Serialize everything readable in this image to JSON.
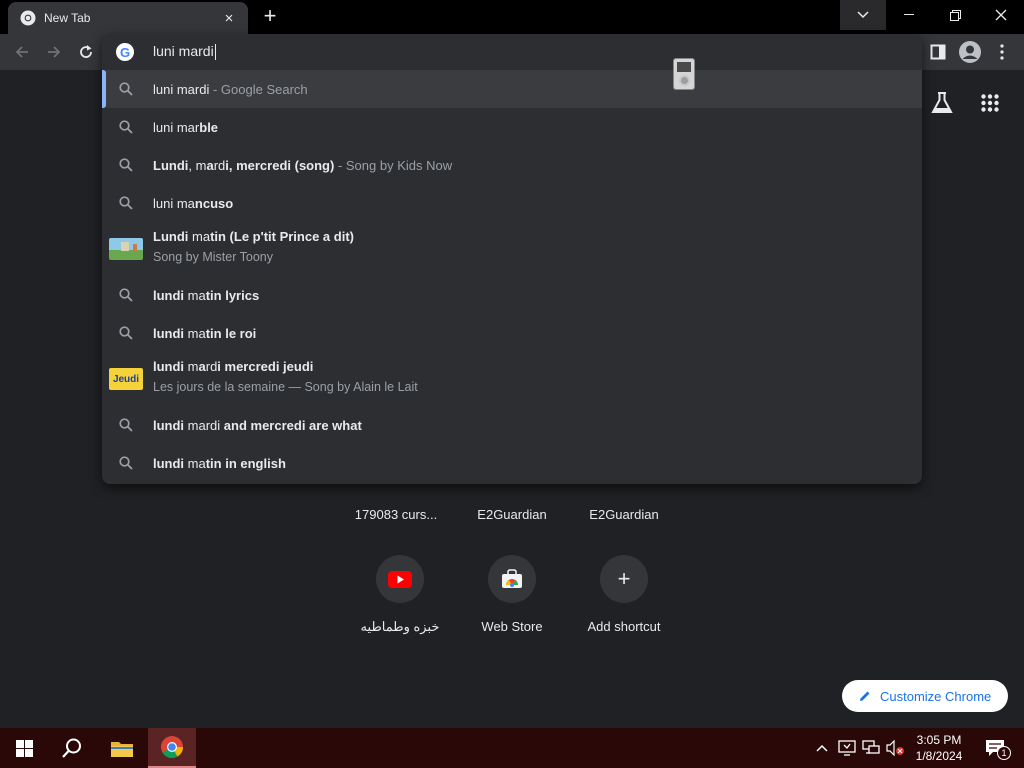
{
  "tab": {
    "title": "New Tab",
    "close_glyph": "×"
  },
  "newtab": {
    "glyph": "+"
  },
  "omnibox": {
    "typed": "luni mardi",
    "suggestions": [
      {
        "parts": [
          {
            "t": "luni mardi",
            "b": false
          }
        ],
        "suffix": " - Google Search",
        "icon": "search-icon",
        "selected": true
      },
      {
        "parts": [
          {
            "t": "luni mar",
            "b": false
          },
          {
            "t": "ble",
            "b": true
          }
        ],
        "icon": "search-icon"
      },
      {
        "parts": [
          {
            "t": "Lundi",
            "b": true
          },
          {
            "t": ", m",
            "b": false
          },
          {
            "t": "a",
            "b": true
          },
          {
            "t": "rd",
            "b": false
          },
          {
            "t": "i, mercredi (song)",
            "b": true
          }
        ],
        "suffix": " - Song by Kids Now",
        "icon": "search-icon"
      },
      {
        "parts": [
          {
            "t": "luni ma",
            "b": false
          },
          {
            "t": "ncuso",
            "b": true
          }
        ],
        "icon": "search-icon"
      },
      {
        "parts": [
          {
            "t": "Lundi",
            "b": true
          },
          {
            "t": " ma",
            "b": false
          },
          {
            "t": "tin (Le p'tit Prince a dit)",
            "b": true
          }
        ],
        "sub": "Song by Mister Toony",
        "icon": "thumbnail-grass"
      },
      {
        "parts": [
          {
            "t": "lundi",
            "b": true
          },
          {
            "t": " ma",
            "b": false
          },
          {
            "t": "tin lyrics",
            "b": true
          }
        ],
        "icon": "search-icon"
      },
      {
        "parts": [
          {
            "t": "lundi",
            "b": true
          },
          {
            "t": " ma",
            "b": false
          },
          {
            "t": "tin le roi",
            "b": true
          }
        ],
        "icon": "search-icon"
      },
      {
        "parts": [
          {
            "t": "lundi",
            "b": true
          },
          {
            "t": " m",
            "b": false
          },
          {
            "t": "a",
            "b": true
          },
          {
            "t": "rd",
            "b": false
          },
          {
            "t": "i mercredi jeudi",
            "b": true
          }
        ],
        "sub": "Les jours de la semaine — Song by Alain le Lait",
        "icon": "thumbnail-jeudi"
      },
      {
        "parts": [
          {
            "t": "lundi",
            "b": true
          },
          {
            "t": " mardi ",
            "b": false
          },
          {
            "t": "and mercredi are what",
            "b": true
          }
        ],
        "icon": "search-icon"
      },
      {
        "parts": [
          {
            "t": "lundi",
            "b": true
          },
          {
            "t": " ma",
            "b": false
          },
          {
            "t": "tin in english",
            "b": true
          }
        ],
        "icon": "search-icon"
      }
    ],
    "thumb_jeudi_text": "Jeudi"
  },
  "shortcuts_row1": [
    {
      "label": "179083 curs..."
    },
    {
      "label": "E2Guardian"
    },
    {
      "label": "E2Guardian"
    }
  ],
  "shortcuts_row2": [
    {
      "label": "خبزه وطماطيه",
      "icon": "youtube-icon"
    },
    {
      "label": "Web Store",
      "icon": "web-store-icon"
    },
    {
      "label": "Add shortcut",
      "icon": "plus-icon",
      "glyph": "+"
    }
  ],
  "customize": {
    "label": "Customize Chrome"
  },
  "clock": {
    "time": "3:05 PM",
    "date": "1/8/2024"
  },
  "notifications": {
    "count": "1"
  }
}
